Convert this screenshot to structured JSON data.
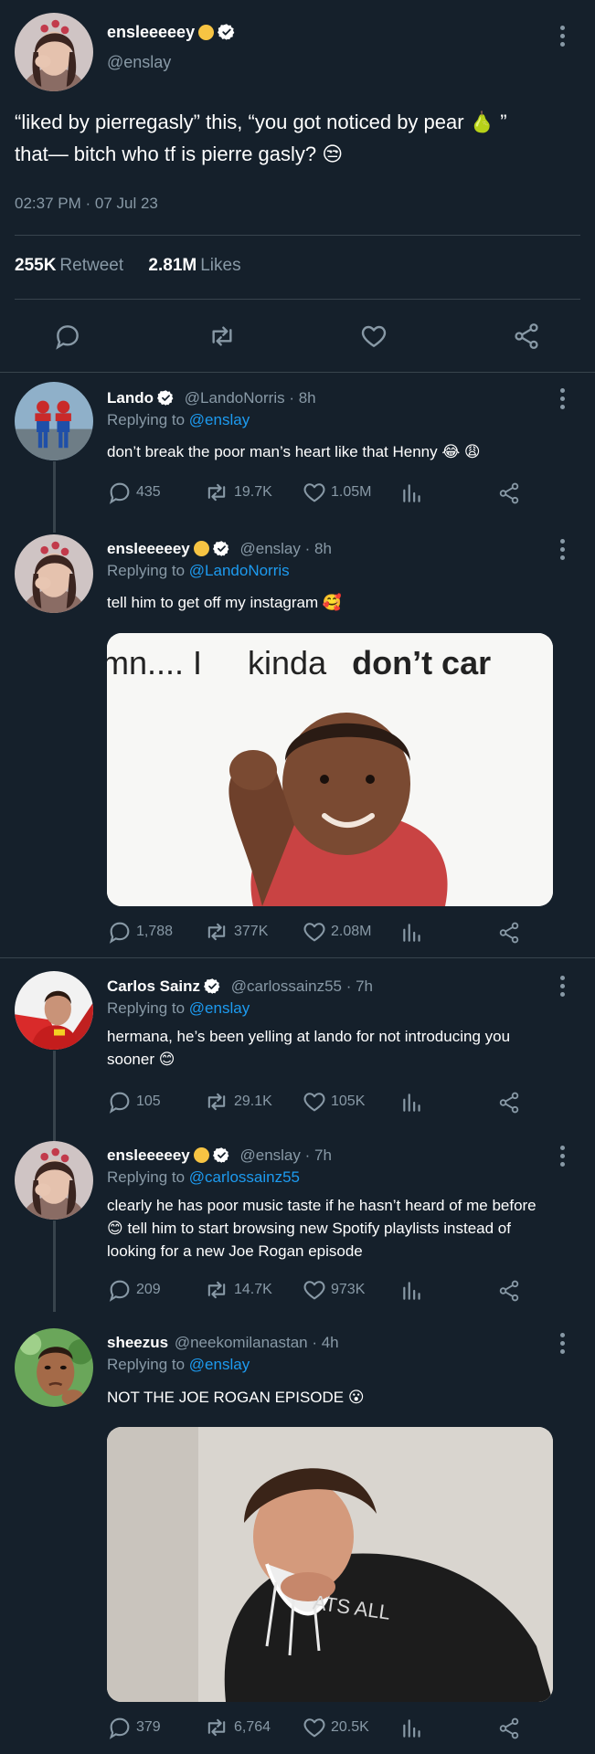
{
  "main_tweet": {
    "display_name": "ensleeeeey",
    "handle": "@enslay",
    "text_line1": "“liked by pierregasly” this, “you got noticed by pear 🍐 ”",
    "text_line2": "that— bitch who tf is pierre gasly? 😒",
    "timestamp": "02:37 PM · 07 Jul 23",
    "retweets": "255K",
    "retweet_label": "Retweet",
    "likes": "2.81M",
    "likes_label": "Likes"
  },
  "replies": [
    {
      "display_name": "Lando",
      "meta": "@LandoNorris · 8h",
      "replying_label": "Replying to",
      "replying_to": "@enslay",
      "text": "don’t break the poor man’s heart like that Henny 😂 😩",
      "replies": "435",
      "retweets": "19.7K",
      "likes": "1.05M"
    },
    {
      "display_name": "ensleeeeey",
      "meta": "@enslay · 8h",
      "replying_label": "Replying to",
      "replying_to": "@LandoNorris",
      "text": "tell him to get off my instagram 🥰",
      "media_caption_1": "mn.... I",
      "media_caption_2": "kinda",
      "media_caption_3": "don’t car",
      "replies": "1,788",
      "retweets": "377K",
      "likes": "2.08M"
    },
    {
      "display_name": "Carlos Sainz",
      "meta": "@carlossainz55 · 7h",
      "replying_label": "Replying to",
      "replying_to": "@enslay",
      "text_line1": "hermana, he’s been yelling at lando for not introducing you",
      "text_line2": "sooner 😊",
      "replies": "105",
      "retweets": "29.1K",
      "likes": "105K"
    },
    {
      "display_name": "ensleeeeey",
      "meta": "@enslay · 7h",
      "replying_label": "Replying to",
      "replying_to": "@carlossainz55",
      "text_line1": "clearly he has poor music taste if he hasn’t heard of me before",
      "text_line2": "😊 tell him to start browsing new Spotify playlists instead of",
      "text_line3": "looking for a new Joe Rogan episode",
      "replies": "209",
      "retweets": "14.7K",
      "likes": "973K"
    },
    {
      "display_name": "sheezus",
      "meta": "@neekomilanastan · 4h",
      "replying_label": "Replying to",
      "replying_to": "@enslay",
      "text": "NOT THE JOE ROGAN EPISODE 😮",
      "shirt_text": "ATS ALL",
      "replies": "379",
      "retweets": "6,764",
      "likes": "20.5K"
    }
  ],
  "colors": {
    "background": "#15202b",
    "divider": "#38444d",
    "secondary_text": "#8899a6",
    "link": "#1d9bf0"
  }
}
